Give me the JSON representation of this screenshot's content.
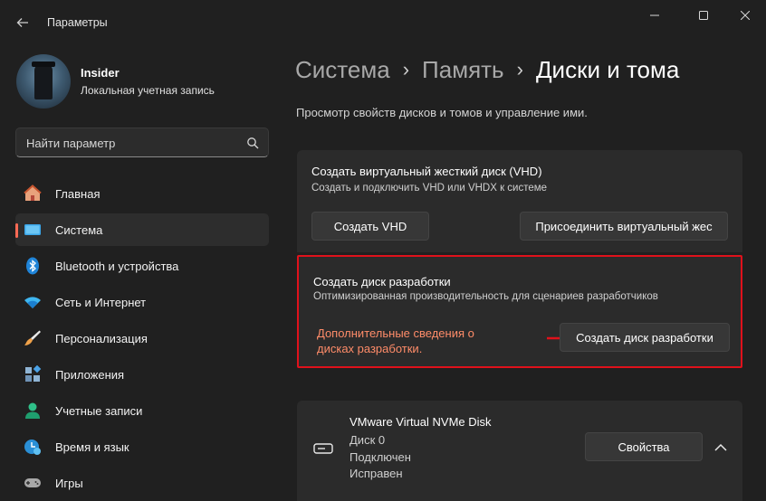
{
  "window": {
    "title": "Параметры"
  },
  "profile": {
    "name": "Insider",
    "account_type": "Локальная учетная запись"
  },
  "search": {
    "placeholder": "Найти параметр"
  },
  "sidebar": {
    "items": [
      {
        "label": "Главная",
        "icon": "home-icon",
        "active": false
      },
      {
        "label": "Система",
        "icon": "system-icon",
        "active": true
      },
      {
        "label": "Bluetooth и устройства",
        "icon": "bluetooth-icon",
        "active": false
      },
      {
        "label": "Сеть и Интернет",
        "icon": "network-icon",
        "active": false
      },
      {
        "label": "Персонализация",
        "icon": "brush-icon",
        "active": false
      },
      {
        "label": "Приложения",
        "icon": "apps-icon",
        "active": false
      },
      {
        "label": "Учетные записи",
        "icon": "accounts-icon",
        "active": false
      },
      {
        "label": "Время и язык",
        "icon": "time-language-icon",
        "active": false
      },
      {
        "label": "Игры",
        "icon": "gaming-icon",
        "active": false
      }
    ]
  },
  "breadcrumb": {
    "parts": [
      "Система",
      "Память"
    ],
    "current": "Диски и тома"
  },
  "subtitle": "Просмотр свойств дисков и томов и управление ими.",
  "vhd_card": {
    "title": "Создать виртуальный жесткий диск (VHD)",
    "description": "Создать и подключить VHD или VHDX к системе",
    "create_button": "Создать VHD",
    "attach_button": "Присоединить виртуальный жес"
  },
  "dev_drive_card": {
    "title": "Создать диск разработки",
    "description": "Оптимизированная производительность для сценариев разработчиков",
    "note": "Дополнительные сведения о дисках разработки.",
    "create_button": "Создать диск разработки"
  },
  "disk": {
    "name": "VMware Virtual NVMe Disk",
    "number": "Диск 0",
    "state": "Подключен",
    "health": "Исправен",
    "properties_button": "Свойства"
  },
  "colors": {
    "accent": "#ff6a55",
    "highlight_border": "#e0111b",
    "note_text": "#ff8c69"
  }
}
